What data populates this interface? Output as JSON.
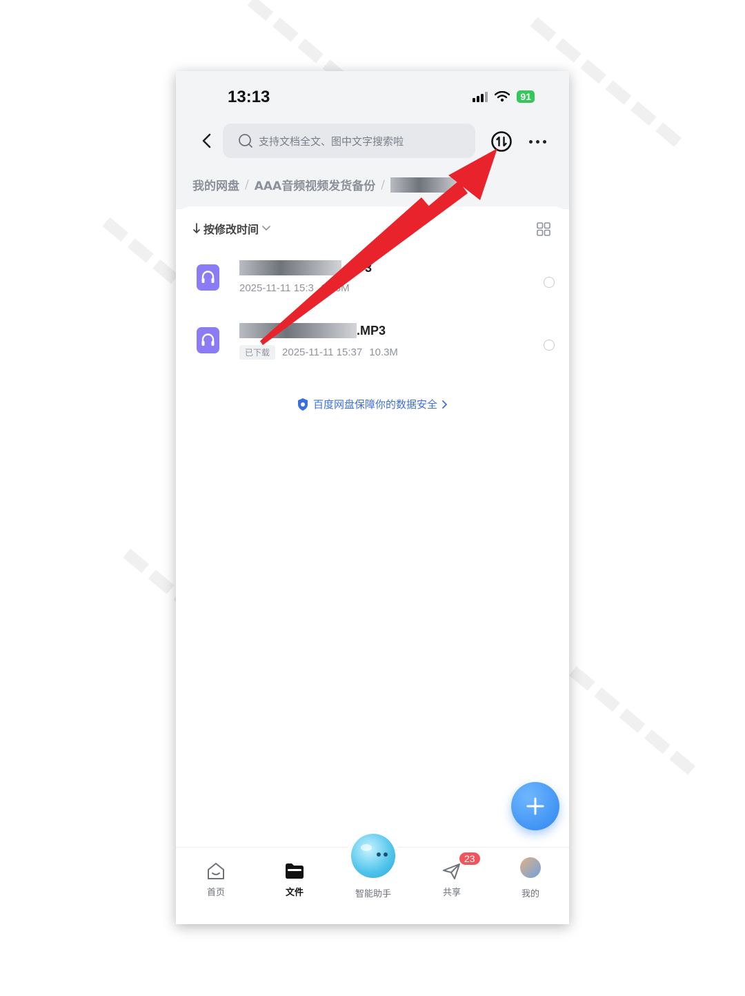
{
  "status_bar": {
    "time": "13:13",
    "battery": "91"
  },
  "search": {
    "placeholder": "支持文档全文、图中文字搜索啦"
  },
  "breadcrumb": {
    "root": "我的网盘",
    "folder": "AAA音频视频发货备份",
    "separator": "/"
  },
  "sort": {
    "label": "按修改时间"
  },
  "files": [
    {
      "name_suffix": "P3",
      "date": "2025-11-11 15:3",
      "size": "10.3M",
      "badge": ""
    },
    {
      "name_suffix": ".MP3",
      "date": "2025-11-11 15:37",
      "size": "10.3M",
      "badge": "已下载"
    }
  ],
  "safety_link": "百度网盘保障你的数据安全",
  "tabs": {
    "home": "首页",
    "files": "文件",
    "assistant": "智能助手",
    "share": "共享",
    "mine": "我的"
  },
  "share_count": "23",
  "colors": {
    "accent": "#3b6fe0",
    "fab": "#2f86f0",
    "arrow": "#e8232b",
    "file_icon": "#8b7cf6",
    "badge_red": "#f2545b",
    "battery": "#34c759"
  },
  "icons": [
    "back-icon",
    "search-icon",
    "transfer-icon",
    "more-icon",
    "sort-arrow-icon",
    "chevron-down-icon",
    "grid-view-icon",
    "audio-file-icon",
    "shield-icon",
    "chevron-right-icon",
    "plus-icon",
    "home-icon",
    "folder-icon",
    "share-icon"
  ]
}
